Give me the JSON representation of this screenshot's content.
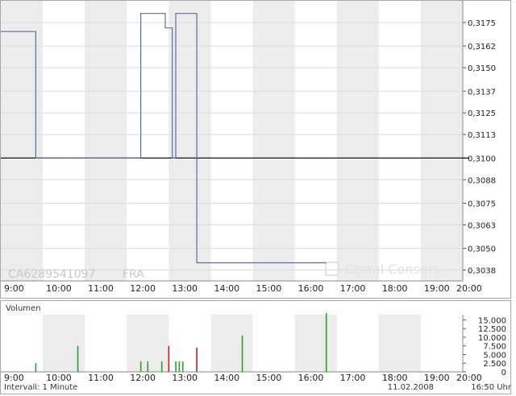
{
  "chart_data": [
    {
      "type": "line",
      "title": "",
      "watermark_symbol": "CA6289541097",
      "watermark_exchange": "FRA",
      "watermark_brand": "Cortal Consors",
      "x_tick_labels": [
        "9:00",
        "10:00",
        "11:00",
        "12:00",
        "13:00",
        "14:00",
        "15:00",
        "16:00",
        "17:00",
        "18:00",
        "19:00",
        "20:00"
      ],
      "xlim": [
        "9:00",
        "20:00"
      ],
      "y_tick_labels": [
        "0,3175",
        "0,3162",
        "0,3150",
        "0,3137",
        "0,3125",
        "0,3113",
        "0,3100",
        "0,3088",
        "0,3075",
        "0,3063",
        "0,3050",
        "0,3038"
      ],
      "ylim": [
        0.3032,
        0.3187
      ],
      "reference_line": 0.31,
      "grid": true,
      "series": [
        {
          "color": "#5a6e9c",
          "points": [
            [
              "9:00",
              0.317
            ],
            [
              "9:50",
              0.317
            ],
            [
              "9:50",
              0.31
            ],
            [
              "12:20",
              0.31
            ],
            [
              "12:20",
              0.318
            ],
            [
              "12:55",
              0.318
            ],
            [
              "12:55",
              0.3172
            ],
            [
              "13:05",
              0.3172
            ],
            [
              "13:05",
              0.31
            ],
            [
              "13:10",
              0.31
            ],
            [
              "13:10",
              0.318
            ],
            [
              "13:40",
              0.318
            ],
            [
              "13:40",
              0.3042
            ],
            [
              "16:45",
              0.3042
            ]
          ]
        }
      ]
    },
    {
      "type": "bar",
      "title": "Volumen",
      "x_tick_labels": [
        "9:00",
        "10:00",
        "11:00",
        "12:00",
        "13:00",
        "14:00",
        "15:00",
        "16:00",
        "17:00",
        "18:00",
        "19:00",
        "20:00"
      ],
      "y_tick_labels": [
        "15.000",
        "12.500",
        "10.000",
        "7.500",
        "5.000",
        "2.500",
        "0"
      ],
      "ylim": [
        0,
        16500
      ],
      "bars": [
        {
          "time": "9:50",
          "value": 2500,
          "color": "#2aa02a"
        },
        {
          "time": "10:50",
          "value": 7500,
          "color": "#2aa02a"
        },
        {
          "time": "12:20",
          "value": 3000,
          "color": "#2aa02a"
        },
        {
          "time": "12:30",
          "value": 3000,
          "color": "#2aa02a"
        },
        {
          "time": "12:50",
          "value": 3000,
          "color": "#2aa02a"
        },
        {
          "time": "13:00",
          "value": 7500,
          "color": "#c02020"
        },
        {
          "time": "13:10",
          "value": 3000,
          "color": "#2aa02a"
        },
        {
          "time": "13:15",
          "value": 3000,
          "color": "#2aa02a"
        },
        {
          "time": "13:20",
          "value": 3000,
          "color": "#2aa02a"
        },
        {
          "time": "13:40",
          "value": 7000,
          "color": "#c02020"
        },
        {
          "time": "14:45",
          "value": 10500,
          "color": "#2aa02a"
        },
        {
          "time": "16:45",
          "value": 17000,
          "color": "#2aa02a"
        }
      ]
    }
  ],
  "footer": {
    "interval": "Intervall: 1 Minute",
    "date": "11.02.2008",
    "time": "16:50 Uhr"
  }
}
